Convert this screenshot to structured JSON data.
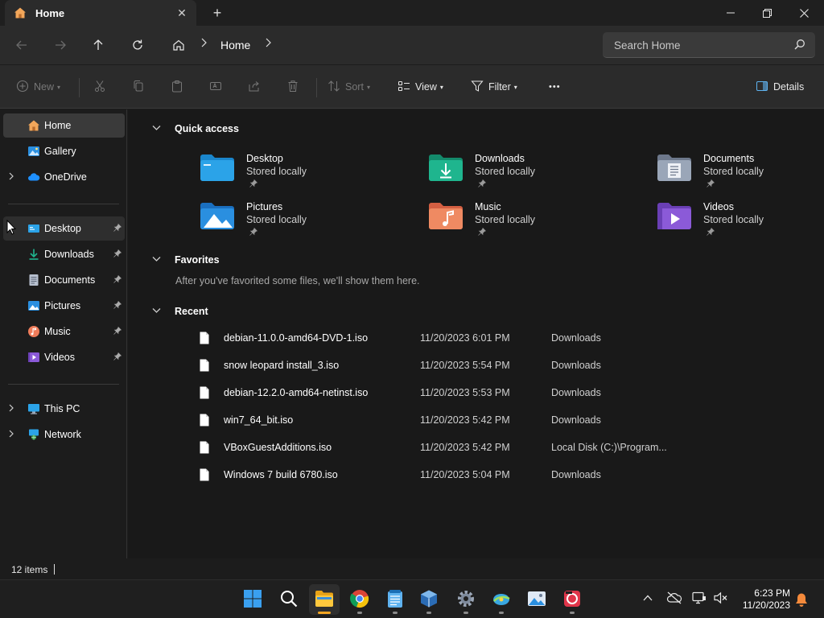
{
  "window": {
    "tab_title": "Home",
    "tab_close": "✕",
    "new_tab": "+"
  },
  "address": {
    "crumbs": [
      "Home"
    ],
    "search_placeholder": "Search Home"
  },
  "commands": {
    "new": "New",
    "sort": "Sort",
    "view": "View",
    "filter": "Filter",
    "more": "•••",
    "details": "Details"
  },
  "sidebar": {
    "top": [
      {
        "label": "Home",
        "icon": "home-icon",
        "selected": true
      },
      {
        "label": "Gallery",
        "icon": "gallery-icon"
      },
      {
        "label": "OneDrive",
        "icon": "cloud-icon",
        "expandable": true
      }
    ],
    "pinned": [
      {
        "label": "Desktop",
        "icon": "desktop-icon",
        "hover": true
      },
      {
        "label": "Downloads",
        "icon": "download-icon"
      },
      {
        "label": "Documents",
        "icon": "document-icon"
      },
      {
        "label": "Pictures",
        "icon": "pictures-icon"
      },
      {
        "label": "Music",
        "icon": "music-icon"
      },
      {
        "label": "Videos",
        "icon": "videos-icon"
      }
    ],
    "bottom": [
      {
        "label": "This PC",
        "icon": "pc-icon"
      },
      {
        "label": "Network",
        "icon": "network-icon"
      }
    ]
  },
  "main": {
    "quick_access": {
      "title": "Quick access",
      "items": [
        {
          "name": "Desktop",
          "sub": "Stored locally",
          "icon": "desktop-folder-icon",
          "color": "#2ba3e8"
        },
        {
          "name": "Downloads",
          "sub": "Stored locally",
          "icon": "downloads-folder-icon",
          "color": "#1fb58e"
        },
        {
          "name": "Documents",
          "sub": "Stored locally",
          "icon": "documents-folder-icon",
          "color": "#8a97ab"
        },
        {
          "name": "Pictures",
          "sub": "Stored locally",
          "icon": "pictures-folder-icon",
          "color": "#2a8fe0"
        },
        {
          "name": "Music",
          "sub": "Stored locally",
          "icon": "music-folder-icon",
          "color": "#ef7c5a"
        },
        {
          "name": "Videos",
          "sub": "Stored locally",
          "icon": "videos-folder-icon",
          "color": "#8b5ad8"
        }
      ]
    },
    "favorites": {
      "title": "Favorites",
      "message": "After you've favorited some files, we'll show them here."
    },
    "recent": {
      "title": "Recent",
      "files": [
        {
          "name": "debian-11.0.0-amd64-DVD-1.iso",
          "date": "11/20/2023 6:01 PM",
          "location": "Downloads"
        },
        {
          "name": "snow leopard install_3.iso",
          "date": "11/20/2023 5:54 PM",
          "location": "Downloads"
        },
        {
          "name": "debian-12.2.0-amd64-netinst.iso",
          "date": "11/20/2023 5:53 PM",
          "location": "Downloads"
        },
        {
          "name": "win7_64_bit.iso",
          "date": "11/20/2023 5:42 PM",
          "location": "Downloads"
        },
        {
          "name": "VBoxGuestAdditions.iso",
          "date": "11/20/2023 5:42 PM",
          "location": "Local Disk (C:)\\Program..."
        },
        {
          "name": "Windows 7 build 6780.iso",
          "date": "11/20/2023 5:04 PM",
          "location": "Downloads"
        }
      ]
    }
  },
  "status": {
    "count": "12 items"
  },
  "taskbar": {
    "time": "6:23 PM",
    "date": "11/20/2023"
  }
}
